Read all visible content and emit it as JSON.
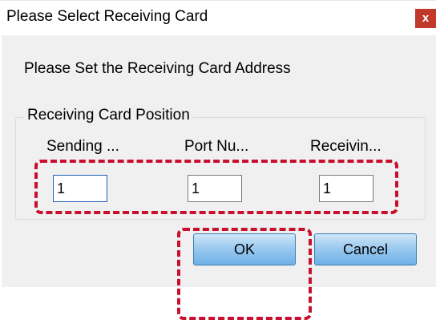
{
  "window": {
    "title": "Please Select Receiving Card",
    "close_label": "x"
  },
  "prompt": "Please Set the Receiving Card Address",
  "group": {
    "label": "Receiving Card Position",
    "columns": [
      "Sending ...",
      "Port Nu...",
      "Receivin..."
    ],
    "values": [
      "1",
      "1",
      "1"
    ]
  },
  "buttons": {
    "ok": "OK",
    "cancel": "Cancel"
  },
  "colors": {
    "highlight": "#c8102e",
    "close_button": "#c0392b"
  }
}
